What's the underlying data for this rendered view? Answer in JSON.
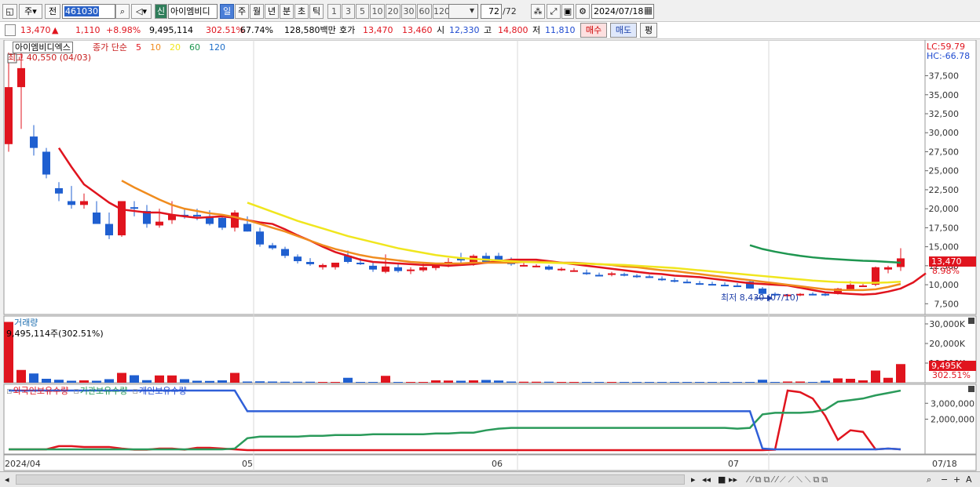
{
  "toolbar": {
    "market_label": "주",
    "prev_label": "전",
    "code_value": "461030",
    "new_label": "신",
    "stock_name": "아이엠비디",
    "periods": [
      "일",
      "주",
      "월",
      "년",
      "분",
      "초",
      "틱"
    ],
    "selected_period": "일",
    "intervals": [
      "1",
      "3",
      "5",
      "10",
      "20",
      "30",
      "60",
      "120"
    ],
    "count_display": "72",
    "count_total": "/72",
    "date_value": "2024/07/18"
  },
  "quote": {
    "price": "13,470",
    "up_arrow": "▲",
    "change": "1,110",
    "change_pct": "+8.98%",
    "volume": "9,495,114",
    "volume_ratio": "302.51%",
    "turnover": "67.74%",
    "amount": "128,580백만",
    "bid_label": "호가",
    "ask_price": "13,470",
    "bid_price": "13,460",
    "open_label": "시",
    "open": "12,330",
    "high_label": "고",
    "high": "14,800",
    "low_label": "저",
    "low": "11,810",
    "buy_label": "매수",
    "sell_label": "매도",
    "avg_label": "평"
  },
  "price_panel": {
    "stock_label": "아이엠비디엑스",
    "ma_title": "종가 단순",
    "ma_periods": [
      "5",
      "10",
      "20",
      "60",
      "120"
    ],
    "max_label": "최고 40,550 (04/03)",
    "min_label": "최저 8,430 (07/10)",
    "lc_label": "LC:59.79",
    "hc_label": "HC:-66.78",
    "current_tag": "13,470",
    "current_pct": "8.98%"
  },
  "volume_panel": {
    "title": "거래량",
    "value_label": "9,495,114주(302.51%)",
    "current_tag": "9,495K",
    "current_pct": "302.51%"
  },
  "holding_panel": {
    "legends": [
      "외국인보유수량",
      "기관보유수량",
      "개인보유수량"
    ]
  },
  "x_axis_labels": [
    "2024/04",
    "05",
    "06",
    "07",
    "07/18"
  ],
  "colors": {
    "up": "#e0141e",
    "down": "#1f5fd0",
    "ma5": "#e0141e",
    "ma10": "#f08c1e",
    "ma20": "#f0e61e",
    "ma60": "#1e9650",
    "ma120": "#1e6ec8"
  },
  "chart_data": [
    {
      "type": "candlestick",
      "title": "아이엠비디엑스",
      "y_ticks": [
        37500,
        35000,
        32500,
        30000,
        27500,
        25000,
        22500,
        20000,
        17500,
        15000,
        12500,
        10000,
        7500
      ],
      "ylim": [
        6500,
        40550
      ],
      "candles": [
        [
          28500,
          40550,
          27500,
          36000
        ],
        [
          36000,
          40550,
          30500,
          38500
        ],
        [
          29500,
          31000,
          27000,
          28000
        ],
        [
          27500,
          28000,
          24000,
          24500
        ],
        [
          22700,
          23500,
          21000,
          22000
        ],
        [
          21000,
          23000,
          20000,
          20500
        ],
        [
          20500,
          22000,
          20000,
          21000
        ],
        [
          19500,
          21000,
          19000,
          18000
        ],
        [
          18000,
          19500,
          16000,
          16500
        ],
        [
          16500,
          21000,
          16300,
          21000
        ],
        [
          20200,
          21000,
          19000,
          20000
        ],
        [
          19700,
          20500,
          17500,
          18000
        ],
        [
          17800,
          20000,
          17500,
          18300
        ],
        [
          18500,
          21000,
          18000,
          19200
        ],
        [
          19200,
          20000,
          18700,
          19000
        ],
        [
          19200,
          20000,
          18500,
          19000
        ],
        [
          19000,
          19800,
          17800,
          18000
        ],
        [
          18800,
          19200,
          17200,
          17500
        ],
        [
          17500,
          19800,
          17000,
          19500
        ],
        [
          18000,
          19000,
          17000,
          17000
        ],
        [
          17000,
          17500,
          15000,
          15300
        ],
        [
          15200,
          15500,
          14600,
          14800
        ],
        [
          14700,
          15000,
          13500,
          13800
        ],
        [
          13700,
          14000,
          12800,
          13100
        ],
        [
          13000,
          13500,
          12500,
          12700
        ],
        [
          12300,
          12800,
          12000,
          12600
        ],
        [
          12300,
          12900,
          12000,
          12900
        ],
        [
          13800,
          14500,
          12800,
          13000
        ],
        [
          12900,
          13500,
          12600,
          12700
        ],
        [
          12500,
          13000,
          11700,
          12000
        ],
        [
          11700,
          14000,
          11500,
          12400
        ],
        [
          12300,
          12800,
          11600,
          11800
        ],
        [
          11800,
          12300,
          11400,
          12000
        ],
        [
          11900,
          12800,
          11700,
          12300
        ],
        [
          12200,
          12900,
          11900,
          12700
        ],
        [
          12700,
          13500,
          12300,
          13000
        ],
        [
          13500,
          14200,
          12900,
          13200
        ],
        [
          13000,
          14000,
          12500,
          13800
        ],
        [
          13800,
          14200,
          12800,
          13000
        ],
        [
          13800,
          14200,
          12900,
          13300
        ],
        [
          13200,
          13600,
          12500,
          12700
        ],
        [
          12600,
          12900,
          12400,
          12600
        ],
        [
          12500,
          12700,
          12300,
          12500
        ],
        [
          12400,
          12600,
          11900,
          12000
        ],
        [
          11900,
          12300,
          11800,
          12100
        ],
        [
          11900,
          12200,
          11700,
          11900
        ],
        [
          11600,
          12000,
          11300,
          11400
        ],
        [
          11300,
          11600,
          11100,
          11200
        ],
        [
          11300,
          11700,
          11100,
          11500
        ],
        [
          11400,
          11600,
          11100,
          11200
        ],
        [
          11200,
          11400,
          10900,
          11000
        ],
        [
          11100,
          11300,
          10900,
          11000
        ],
        [
          10800,
          11100,
          10500,
          10600
        ],
        [
          10600,
          10900,
          10300,
          10400
        ],
        [
          10400,
          10700,
          10200,
          10300
        ],
        [
          10200,
          10500,
          10000,
          10100
        ],
        [
          10100,
          10400,
          9900,
          10000
        ],
        [
          10000,
          10300,
          9800,
          9900
        ],
        [
          9900,
          10200,
          9700,
          9800
        ],
        [
          10400,
          10700,
          9500,
          9500
        ],
        [
          9500,
          9700,
          8600,
          8800
        ],
        [
          8800,
          9000,
          8430,
          8600
        ],
        [
          8600,
          8800,
          8450,
          8700
        ],
        [
          8700,
          8900,
          8500,
          8800
        ],
        [
          8800,
          9000,
          8600,
          8700
        ],
        [
          8800,
          9000,
          8500,
          8600
        ],
        [
          8800,
          9600,
          8700,
          9500
        ],
        [
          9400,
          10500,
          9200,
          10000
        ],
        [
          9900,
          10100,
          9700,
          9900
        ],
        [
          10000,
          12400,
          9800,
          12300
        ],
        [
          12000,
          12500,
          11500,
          12300
        ],
        [
          12330,
          14800,
          11810,
          13470
        ]
      ],
      "ma_series": [
        {
          "name": "5",
          "start": 4,
          "values": [
            28000,
            25500,
            23200,
            22000,
            20800,
            19900,
            19700,
            19500,
            19500,
            19200,
            19000,
            18800,
            18900,
            19000,
            18800,
            18500,
            18200,
            18000,
            17300,
            16500,
            15800,
            15000,
            14300,
            13800,
            13300,
            13000,
            12900,
            12800,
            12700,
            12600,
            12600,
            12500,
            12600,
            12700,
            12900,
            13100,
            13300,
            13300,
            13300,
            13100,
            12900,
            12700,
            12500,
            12300,
            12100,
            11900,
            11700,
            11500,
            11400,
            11200,
            11100,
            11000,
            10800,
            10600,
            10400,
            10200,
            10100,
            10000,
            9900,
            9600,
            9300,
            9000,
            8900,
            8800,
            8700,
            8800,
            9100,
            9500,
            10300,
            11500
          ]
        },
        {
          "name": "10",
          "start": 9,
          "values": [
            23700,
            22800,
            22000,
            21200,
            20500,
            20000,
            19700,
            19400,
            19200,
            18900,
            18500,
            18000,
            17500,
            17000,
            16400,
            15800,
            15200,
            14700,
            14300,
            13900,
            13600,
            13400,
            13200,
            13000,
            12900,
            12800,
            12800,
            12800,
            12900,
            12900,
            12900,
            12900,
            13000,
            13000,
            13000,
            12900,
            12900,
            12800,
            12700,
            12600,
            12400,
            12300,
            12100,
            11900,
            11800,
            11600,
            11400,
            11200,
            11000,
            10800,
            10600,
            10400,
            10200,
            10000,
            9800,
            9600,
            9400,
            9300,
            9300,
            9300,
            9400,
            9700,
            10100
          ]
        },
        {
          "name": "20",
          "start": 19,
          "values": [
            20800,
            20200,
            19600,
            19000,
            18400,
            17900,
            17400,
            16900,
            16400,
            16000,
            15600,
            15200,
            14800,
            14500,
            14200,
            13900,
            13700,
            13500,
            13400,
            13300,
            13200,
            13100,
            13000,
            12950,
            12900,
            12850,
            12800,
            12750,
            12700,
            12650,
            12600,
            12500,
            12400,
            12300,
            12200,
            12050,
            11900,
            11750,
            11600,
            11450,
            11300,
            11150,
            11000,
            10850,
            10700,
            10550,
            10450,
            10350,
            10300,
            10250,
            10250,
            10300,
            10400
          ]
        },
        {
          "name": "60",
          "start": 59,
          "values": [
            15200,
            14700,
            14350,
            14050,
            13800,
            13600,
            13450,
            13350,
            13250,
            13150,
            13100,
            13000,
            12900
          ]
        },
        {
          "name": "120",
          "start": 72,
          "values": []
        }
      ]
    },
    {
      "type": "bar",
      "title": "거래량",
      "y_ticks": [
        30000,
        20000,
        10000
      ],
      "unit": "K",
      "ylim": [
        0,
        34000
      ],
      "values": [
        31000,
        6500,
        4700,
        2000,
        1500,
        1000,
        1200,
        1000,
        1800,
        5000,
        3800,
        1300,
        3700,
        3700,
        1800,
        1000,
        900,
        1200,
        5000,
        600,
        700,
        600,
        500,
        500,
        500,
        400,
        400,
        2500,
        400,
        400,
        3500,
        400,
        400,
        400,
        1200,
        1100,
        1000,
        1200,
        1400,
        1100,
        600,
        500,
        500,
        500,
        400,
        400,
        400,
        400,
        400,
        400,
        400,
        400,
        400,
        400,
        400,
        400,
        400,
        400,
        400,
        400,
        1500,
        400,
        600,
        600,
        400,
        1000,
        2200,
        2000,
        1200,
        6200,
        2500,
        9495
      ]
    },
    {
      "type": "line",
      "title": "보유수량",
      "y_ticks": [
        3000000,
        2000000
      ],
      "ylim": [
        0,
        4000000
      ],
      "series": [
        {
          "name": "외국인보유수량",
          "values": [
            100000,
            100000,
            100000,
            100000,
            300000,
            300000,
            250000,
            250000,
            250000,
            150000,
            80000,
            80000,
            150000,
            150000,
            80000,
            200000,
            200000,
            150000,
            100000,
            50000,
            50000,
            50000,
            50000,
            50000,
            50000,
            50000,
            50000,
            50000,
            50000,
            50000,
            50000,
            50000,
            50000,
            50000,
            50000,
            50000,
            50000,
            50000,
            50000,
            50000,
            50000,
            50000,
            50000,
            50000,
            50000,
            50000,
            50000,
            50000,
            50000,
            50000,
            50000,
            50000,
            50000,
            50000,
            50000,
            50000,
            50000,
            50000,
            50000,
            50000,
            50000,
            80000,
            3800000,
            3700000,
            3300000,
            2200000,
            700000,
            1300000,
            1200000,
            100000,
            150000,
            100000
          ]
        },
        {
          "name": "기관보유수량",
          "values": [
            100000,
            100000,
            100000,
            100000,
            100000,
            100000,
            100000,
            100000,
            100000,
            100000,
            100000,
            100000,
            100000,
            100000,
            100000,
            100000,
            100000,
            100000,
            150000,
            800000,
            900000,
            900000,
            900000,
            900000,
            950000,
            950000,
            1000000,
            1000000,
            1000000,
            1050000,
            1050000,
            1050000,
            1050000,
            1050000,
            1100000,
            1100000,
            1150000,
            1150000,
            1300000,
            1400000,
            1450000,
            1450000,
            1450000,
            1450000,
            1450000,
            1450000,
            1450000,
            1450000,
            1450000,
            1450000,
            1450000,
            1450000,
            1450000,
            1450000,
            1450000,
            1450000,
            1450000,
            1450000,
            1400000,
            1450000,
            2300000,
            2400000,
            2400000,
            2400000,
            2450000,
            2600000,
            3100000,
            3200000,
            3300000,
            3500000,
            3650000,
            3800000
          ]
        },
        {
          "name": "개인보유수량",
          "values": [
            3800000,
            3800000,
            3800000,
            3800000,
            3800000,
            3800000,
            3800000,
            3800000,
            3800000,
            3800000,
            3800000,
            3800000,
            3800000,
            3800000,
            3800000,
            3800000,
            3800000,
            3800000,
            3800000,
            2500000,
            2500000,
            2500000,
            2500000,
            2500000,
            2500000,
            2500000,
            2500000,
            2500000,
            2500000,
            2500000,
            2500000,
            2500000,
            2500000,
            2500000,
            2500000,
            2500000,
            2500000,
            2500000,
            2500000,
            2500000,
            2500000,
            2500000,
            2500000,
            2500000,
            2500000,
            2500000,
            2500000,
            2500000,
            2500000,
            2500000,
            2500000,
            2500000,
            2500000,
            2500000,
            2500000,
            2500000,
            2500000,
            2500000,
            2500000,
            2500000,
            150000,
            100000,
            100000,
            100000,
            100000,
            100000,
            100000,
            100000,
            100000,
            100000,
            150000,
            100000
          ]
        }
      ]
    }
  ]
}
